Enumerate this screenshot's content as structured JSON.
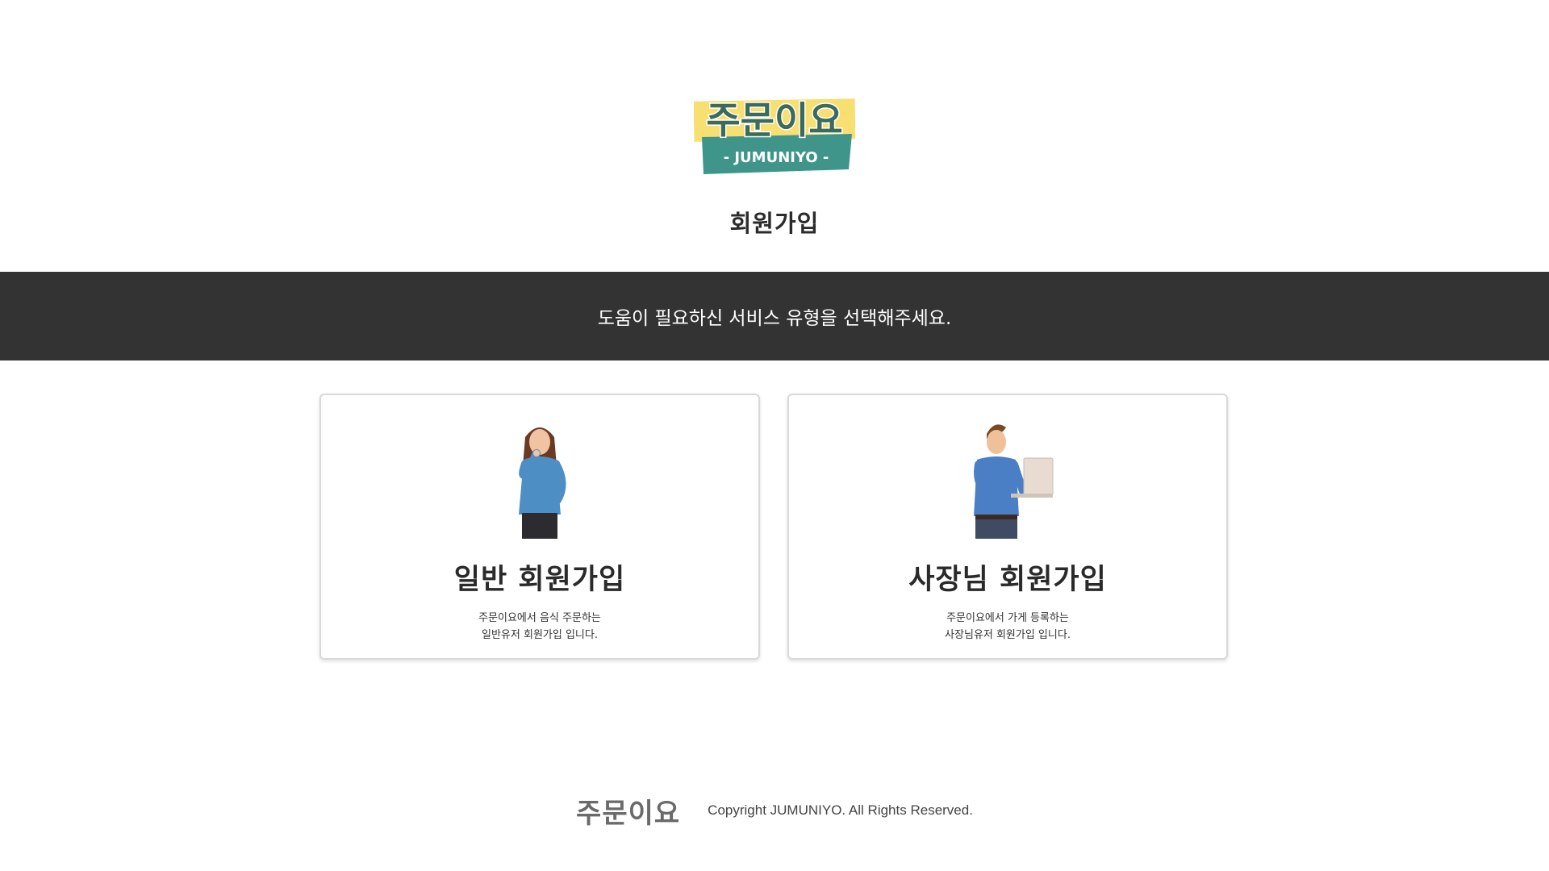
{
  "logo": {
    "korean": "주문이요",
    "english": "- JUMUNIYO -",
    "colors": {
      "yellow": "#f7df72",
      "teal": "#3f9589",
      "text_dark": "#3d6b5a"
    }
  },
  "page_title": "회원가입",
  "banner": {
    "text": "도움이 필요하신 서비스 유형을 선택해주세요.",
    "background": "#333333"
  },
  "cards": [
    {
      "title": "일반 회원가입",
      "desc_line1": "주문이요에서 음식 주문하는",
      "desc_line2": "일반유저 회원가입 입니다.",
      "illustration": "woman-thinking-icon"
    },
    {
      "title": "사장님 회원가입",
      "desc_line1": "주문이요에서 가게 등록하는",
      "desc_line2": "사장님유저 회원가입 입니다.",
      "illustration": "man-with-laptop-icon"
    }
  ],
  "footer": {
    "logo": "주문이요",
    "copyright": "Copyright JUMUNIYO. All Rights Reserved."
  }
}
